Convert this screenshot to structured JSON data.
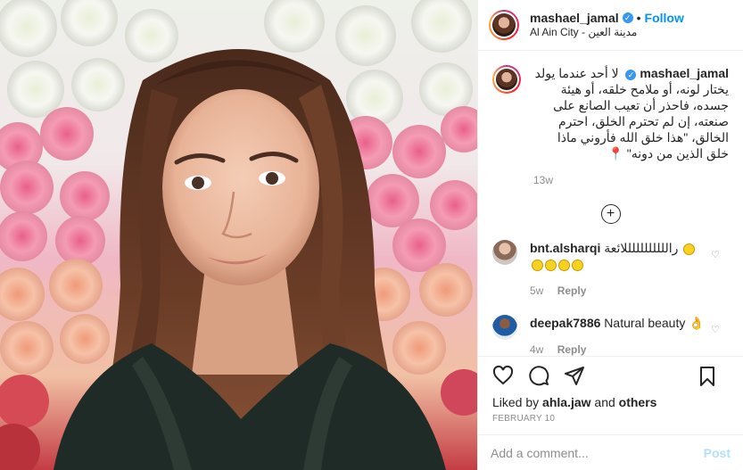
{
  "post": {
    "username": "mashael_jamal",
    "follow_label": "Follow",
    "location": "Al Ain City - مدينة العين",
    "caption": "لا أحد عندما يولد يختار لونه، أو ملامح خلقه، أو هيئة جسده، فاحذر أن تعيب الصانع على صنعته، إن لم تحترم الخلق، احترم الخالق، \"هذا خلق الله فأروني ماذا خلق الذين من دونه\"",
    "caption_time": "13w",
    "likes_prefix": "Liked by",
    "likes_user": "ahla.jaw",
    "likes_joiner": "and",
    "likes_others": "others",
    "date": "FEBRUARY 10",
    "comment_placeholder": "Add a comment...",
    "post_label": "Post"
  },
  "comments": [
    {
      "username": "bnt.alsharqi",
      "text": "رالللللللللللائعة",
      "time": "5w",
      "reply": "Reply"
    },
    {
      "username": "deepak7886",
      "text": "Natural beauty",
      "time": "4w",
      "reply": "Reply"
    }
  ],
  "icons": {
    "verified": "verified-badge-icon",
    "load_more": "plus-circle-icon",
    "like": "heart-icon",
    "comment": "comment-icon",
    "share": "share-icon",
    "save": "bookmark-icon"
  },
  "colors": {
    "link_blue": "#0095f6",
    "text": "#262626",
    "muted": "#8e8e8e",
    "post_disabled": "#b2dffc"
  }
}
